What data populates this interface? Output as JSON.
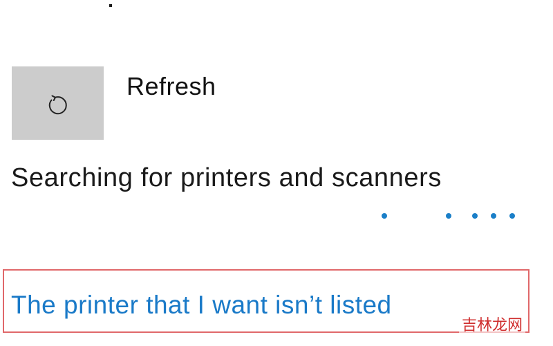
{
  "refresh": {
    "label": "Refresh",
    "icon": "refresh-icon"
  },
  "status": {
    "text": "Searching for printers and scanners"
  },
  "progress": {
    "dot_count": 5,
    "color": "#1a7fc8"
  },
  "not_listed_link": {
    "label": "The printer that I want isn’t listed",
    "color": "#1a7ac8",
    "highlight_border_color": "#e0686a"
  },
  "watermark": {
    "text": "吉林龙网"
  }
}
